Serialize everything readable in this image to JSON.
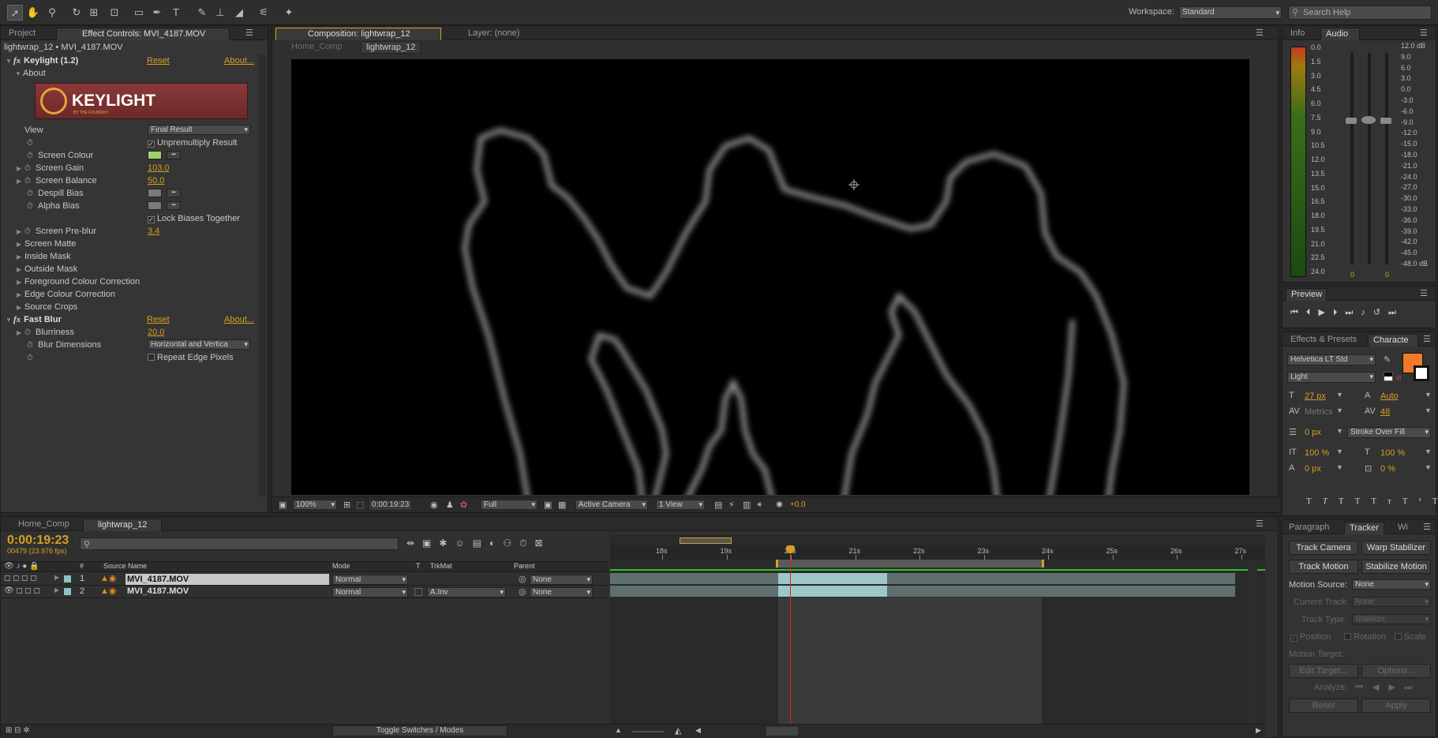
{
  "workspace": {
    "label": "Workspace:",
    "value": "Standard"
  },
  "search": {
    "placeholder": "Search Help"
  },
  "left_panel": {
    "tabs": [
      "Project",
      "Effect Controls: MVI_4187.MOV"
    ],
    "title": "lightwrap_12 • MVI_4187.MOV",
    "logo_text": "KEYLIGHT",
    "logo_sub": "BY THE FOUNDRY",
    "effects": [
      {
        "name": "Keylight (1.2)",
        "reset": "Reset",
        "about": "About...",
        "fx": "fx"
      },
      {
        "name": "Fast Blur",
        "reset": "Reset",
        "about": "About...",
        "fx": "fx"
      }
    ],
    "about_label": "About",
    "props": {
      "view": {
        "label": "View",
        "value": "Final Result"
      },
      "unpremultiply": "Unpremultiply Result",
      "screen_colour": "Screen Colour",
      "screen_gain": {
        "label": "Screen Gain",
        "value": "103.0"
      },
      "screen_balance": {
        "label": "Screen Balance",
        "value": "50.0"
      },
      "despill_bias": "Despill Bias",
      "alpha_bias": "Alpha Bias",
      "lock_biases": "Lock Biases Together",
      "screen_preblur": {
        "label": "Screen Pre-blur",
        "value": "3.4"
      },
      "groups": [
        "Screen Matte",
        "Inside Mask",
        "Outside Mask",
        "Foreground Colour Correction",
        "Edge Colour Correction",
        "Source Crops"
      ],
      "blurriness": {
        "label": "Blurriness",
        "value": "20.0"
      },
      "blur_dimensions": {
        "label": "Blur Dimensions",
        "value": "Horizontal and Vertica"
      },
      "repeat_edge": "Repeat Edge Pixels"
    }
  },
  "comp": {
    "tabs": [
      "Composition: lightwrap_12",
      "Layer: (none)"
    ],
    "breadcrumbs": [
      "Home_Comp",
      "lightwrap_12"
    ],
    "footer": {
      "zoom": "100%",
      "timecode": "0:00:19:23",
      "resolution": "Full",
      "camera": "Active Camera",
      "views": "1 View",
      "exposure": "+0.0"
    }
  },
  "info_panel": {
    "tabs": [
      "Info",
      "Audio"
    ],
    "left_scale": [
      "0.0",
      "1.5",
      "3.0",
      "4.5",
      "6.0",
      "7.5",
      "9.0",
      "10.5",
      "12.0",
      "13.5",
      "15.0",
      "16.5",
      "18.0",
      "19.5",
      "21.0",
      "22.5",
      "24.0"
    ],
    "right_scale": [
      "12.0 dB",
      "9.0",
      "6.0",
      "3.0",
      "0.0",
      "-3.0",
      "-6.0",
      "-9.0",
      "-12.0",
      "-15.0",
      "-18.0",
      "-21.0",
      "-24.0",
      "-27.0",
      "-30.0",
      "-33.0",
      "-36.0",
      "-39.0",
      "-42.0",
      "-45.0",
      "-48.0 dB"
    ],
    "left_value": "0",
    "right_value": "0"
  },
  "preview": {
    "tab": "Preview"
  },
  "character": {
    "tabs": [
      "Effects & Presets",
      "Characte"
    ],
    "font": "Helvetica LT Std",
    "style": "Light",
    "size": "27 px",
    "leading": "Auto",
    "kerning": "Metrics",
    "tracking": "48",
    "stroke_width": "0 px",
    "stroke_mode": "Stroke Over Fill",
    "vscale": "100 %",
    "hscale": "100 %",
    "baseline": "0 px",
    "tsume": "0 %",
    "fill_color": "#f07a28"
  },
  "tracker": {
    "tabs": [
      "Paragraph",
      "Tracker",
      "Wi"
    ],
    "buttons": [
      "Track Camera",
      "Warp Stabilizer",
      "Track Motion",
      "Stabilize Motion"
    ],
    "motion_source": {
      "label": "Motion Source:",
      "value": "None"
    },
    "current_track": {
      "label": "Current Track:",
      "value": "None"
    },
    "track_type": {
      "label": "Track Type:",
      "value": "Stabilize"
    },
    "checks": [
      "Position",
      "Rotation",
      "Scale"
    ],
    "motion_target": "Motion Target:",
    "edit_target": "Edit Target...",
    "options": "Options...",
    "analyze": "Analyze:",
    "reset": "Reset",
    "apply": "Apply"
  },
  "timeline": {
    "tabs": [
      "Home_Comp",
      "lightwrap_12"
    ],
    "timecode": "0:00:19:23",
    "frames": "00479 (23.976 fps)",
    "columns": {
      "hash": "#",
      "source": "Source Name",
      "mode": "Mode",
      "t": "T",
      "trkmat": "TrkMat",
      "parent": "Parent"
    },
    "layers": [
      {
        "num": "1",
        "name": "MVI_4187.MOV",
        "mode": "Normal",
        "trkmat": "",
        "parent": "None"
      },
      {
        "num": "2",
        "name": "MVI_4187.MOV",
        "mode": "Normal",
        "trkmat": "A.Inv",
        "parent": "None"
      }
    ],
    "ruler": [
      "18s",
      "19s",
      "20s",
      "21s",
      "22s",
      "23s",
      "24s",
      "25s",
      "26s",
      "27s"
    ],
    "toggle": "Toggle Switches / Modes"
  }
}
